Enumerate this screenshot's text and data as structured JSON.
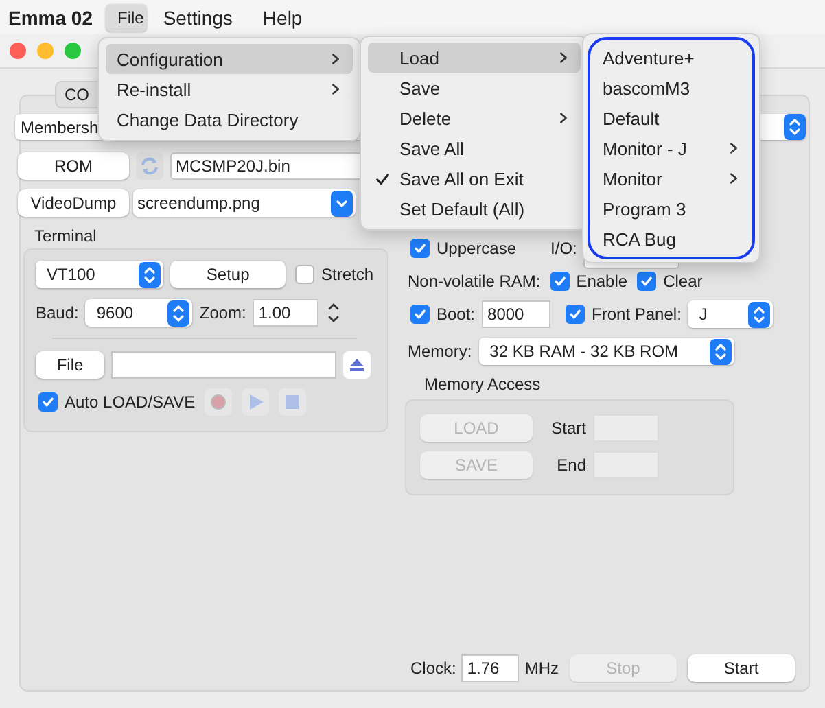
{
  "menu_bar": {
    "app_name": "Emma 02",
    "menus": [
      {
        "label": "File",
        "selected": true
      },
      {
        "label": "Settings",
        "selected": false
      },
      {
        "label": "Help",
        "selected": false
      }
    ]
  },
  "file_menu": {
    "items": [
      {
        "label": "Configuration",
        "has_submenu": true,
        "selected": true
      },
      {
        "label": "Re-install",
        "has_submenu": true,
        "selected": false
      },
      {
        "label": "Change Data Directory",
        "has_submenu": false,
        "selected": false
      }
    ]
  },
  "configuration_menu": {
    "items": [
      {
        "label": "Load",
        "has_submenu": true,
        "selected": true,
        "checked": false
      },
      {
        "label": "Save",
        "has_submenu": false,
        "selected": false,
        "checked": false
      },
      {
        "label": "Delete",
        "has_submenu": true,
        "selected": false,
        "checked": false
      },
      {
        "label": "Save All",
        "has_submenu": false,
        "selected": false,
        "checked": false
      },
      {
        "label": "Save All on Exit",
        "has_submenu": false,
        "selected": false,
        "checked": true
      },
      {
        "label": "Set Default (All)",
        "has_submenu": false,
        "selected": false,
        "checked": false
      }
    ]
  },
  "load_menu": {
    "focused": true,
    "items": [
      {
        "label": "Adventure+",
        "has_submenu": false
      },
      {
        "label": "bascomM3",
        "has_submenu": false
      },
      {
        "label": "Default",
        "has_submenu": false
      },
      {
        "label": "Monitor - J",
        "has_submenu": true
      },
      {
        "label": "Monitor",
        "has_submenu": true
      },
      {
        "label": "Program 3",
        "has_submenu": false
      },
      {
        "label": "RCA Bug",
        "has_submenu": false
      }
    ]
  },
  "window": {
    "tab": "CO",
    "machine_select": "Membersh",
    "rom_button": "ROM",
    "rom_file": "MCSMP20J.bin",
    "videodump_button": "VideoDump",
    "videodump_file": "screendump.png",
    "terminal": {
      "title": "Terminal",
      "type": "VT100",
      "setup_button": "Setup",
      "stretch": {
        "label": "Stretch",
        "checked": false
      },
      "baud_label": "Baud:",
      "baud": "9600",
      "zoom_label": "Zoom:",
      "zoom": "1.00",
      "file_button": "File",
      "auto_load_save": {
        "label": "Auto LOAD/SAVE",
        "checked": true
      }
    },
    "uppercase": {
      "label": "Uppercase",
      "checked": true
    },
    "io_label": "I/O:",
    "nvram_label": "Non-volatile RAM:",
    "nvram_enable": {
      "label": "Enable",
      "checked": true
    },
    "nvram_clear": {
      "label": "Clear",
      "checked": true
    },
    "boot": {
      "label": "Boot:",
      "checked": true,
      "value": "8000"
    },
    "front_panel": {
      "label": "Front Panel:",
      "checked": true,
      "value": "J"
    },
    "memory_label": "Memory:",
    "memory": "32 KB RAM - 32 KB ROM",
    "memory_access": {
      "title": "Memory Access",
      "load_button": {
        "label": "LOAD",
        "disabled": true
      },
      "save_button": {
        "label": "SAVE",
        "disabled": true
      },
      "start_label": "Start",
      "end_label": "End"
    },
    "clock_label": "Clock:",
    "clock": "1.76",
    "clock_unit": "MHz",
    "stop_button": {
      "label": "Stop",
      "disabled": true
    },
    "start_button": {
      "label": "Start",
      "disabled": false
    }
  }
}
